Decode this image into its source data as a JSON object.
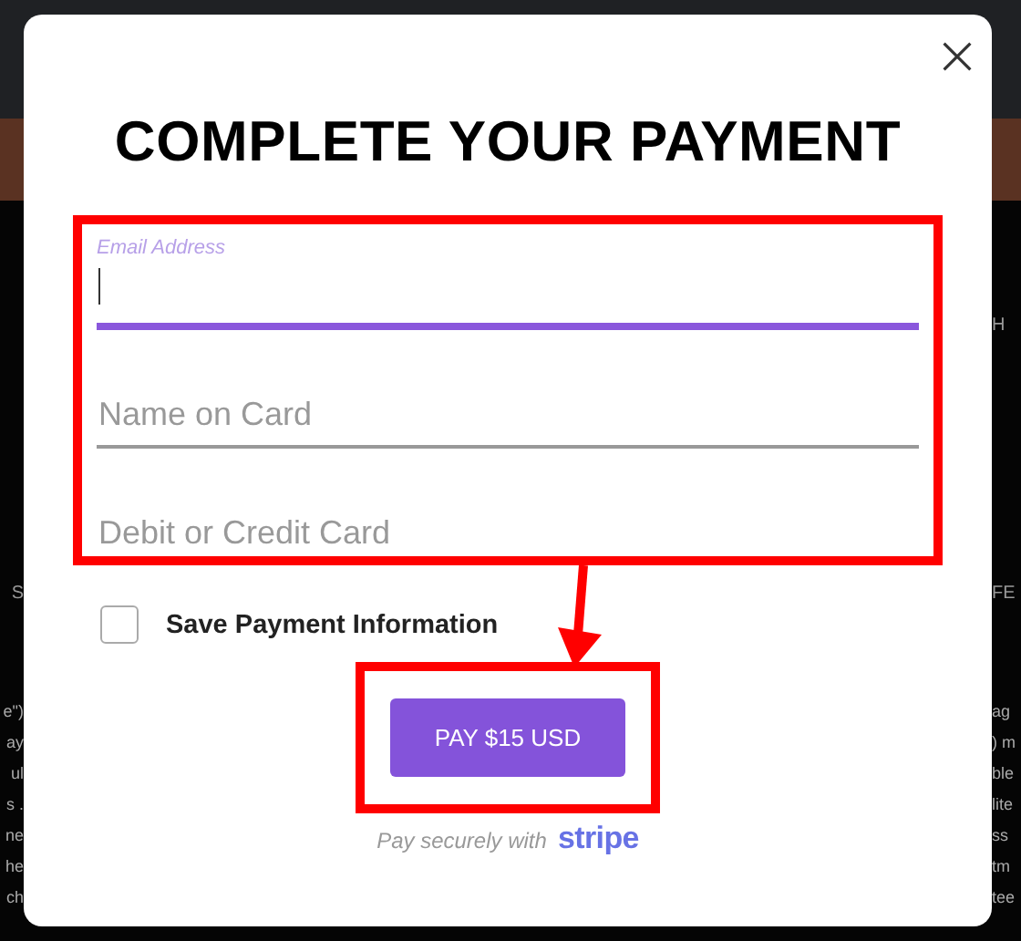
{
  "background": {
    "left": {
      "labels": [
        "S"
      ],
      "lines": [
        "e\")",
        "ay",
        "ul",
        "s .",
        "ne",
        "he",
        "ch"
      ]
    },
    "right": {
      "labels": [
        "H",
        "FE"
      ],
      "lines": [
        "ag",
        ") m",
        "ble",
        "lite",
        "ss",
        "tm",
        "tee"
      ]
    }
  },
  "modal": {
    "title": "COMPLETE YOUR PAYMENT",
    "fields": [
      {
        "kind": "floating",
        "label": "Email Address",
        "focused": true
      },
      {
        "kind": "plain",
        "placeholder": "Name on Card",
        "focused": false
      },
      {
        "kind": "plain",
        "placeholder": "Debit or Credit Card",
        "focused": false
      }
    ],
    "save_payment": {
      "label": "Save Payment Information",
      "checked": false
    },
    "pay_button": "PAY $15 USD",
    "secure_note": "Pay securely with",
    "brand": "stripe"
  }
}
